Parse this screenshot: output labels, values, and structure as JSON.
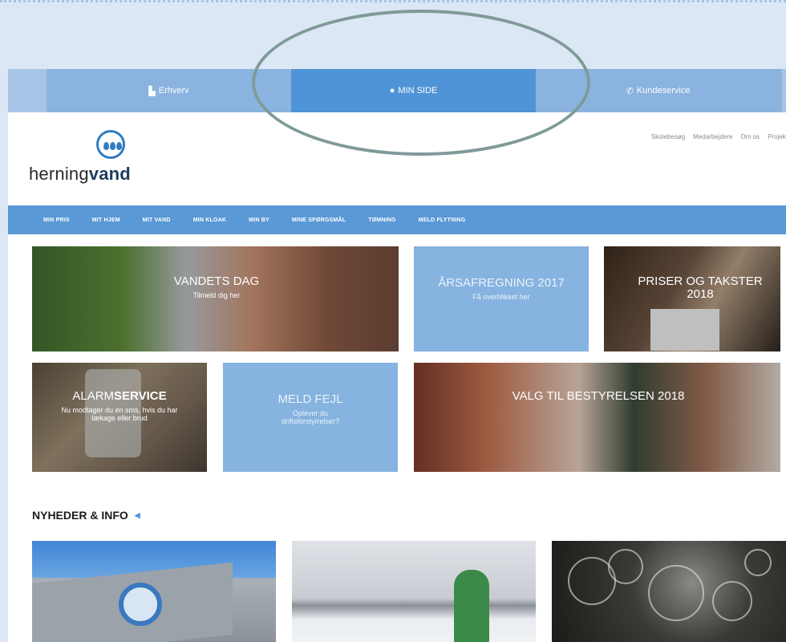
{
  "topbar": {
    "erhverv": "Erhverv",
    "min_side": "MIN SIDE",
    "kundeservice": "Kundeservice"
  },
  "logo": {
    "light": "herning",
    "bold": "vand"
  },
  "util_links": [
    "Skolebesøg",
    "Medarbejdere",
    "Om os",
    "Projekt"
  ],
  "nav": [
    "MIN PRIS",
    "MIT HJEM",
    "MIT VAND",
    "MIN KLOAK",
    "MIN BY",
    "MINE SPØRGSMÅL",
    "TØMNING",
    "MELD FLYTNING"
  ],
  "tiles": {
    "vandets_dag": {
      "title": "VANDETS DAG",
      "sub": "Tilmeld dig her"
    },
    "aarsafregning": {
      "title": "ÅRSAFREGNING 2017",
      "sub": "Få overblikket her"
    },
    "priser": {
      "title": "PRISER OG TAKSTER 2018"
    },
    "alarm": {
      "title_light": "ALARM",
      "title_bold": "SERVICE",
      "sub": "Nu modtager du en sms, hvis du har lækage eller brud"
    },
    "meld_fejl": {
      "title": "MELD FEJL",
      "sub": "Oplever du driftsforstyrrelser?"
    },
    "valg": {
      "title": "VALG TIL BESTYRELSEN 2018"
    }
  },
  "news": {
    "title": "NYHEDER & INFO"
  },
  "colors": {
    "nav_blue": "#5a98d6",
    "topbar_active": "#4f94d6",
    "tile_blue": "#86b3df",
    "annotation": "#7f9a98"
  }
}
